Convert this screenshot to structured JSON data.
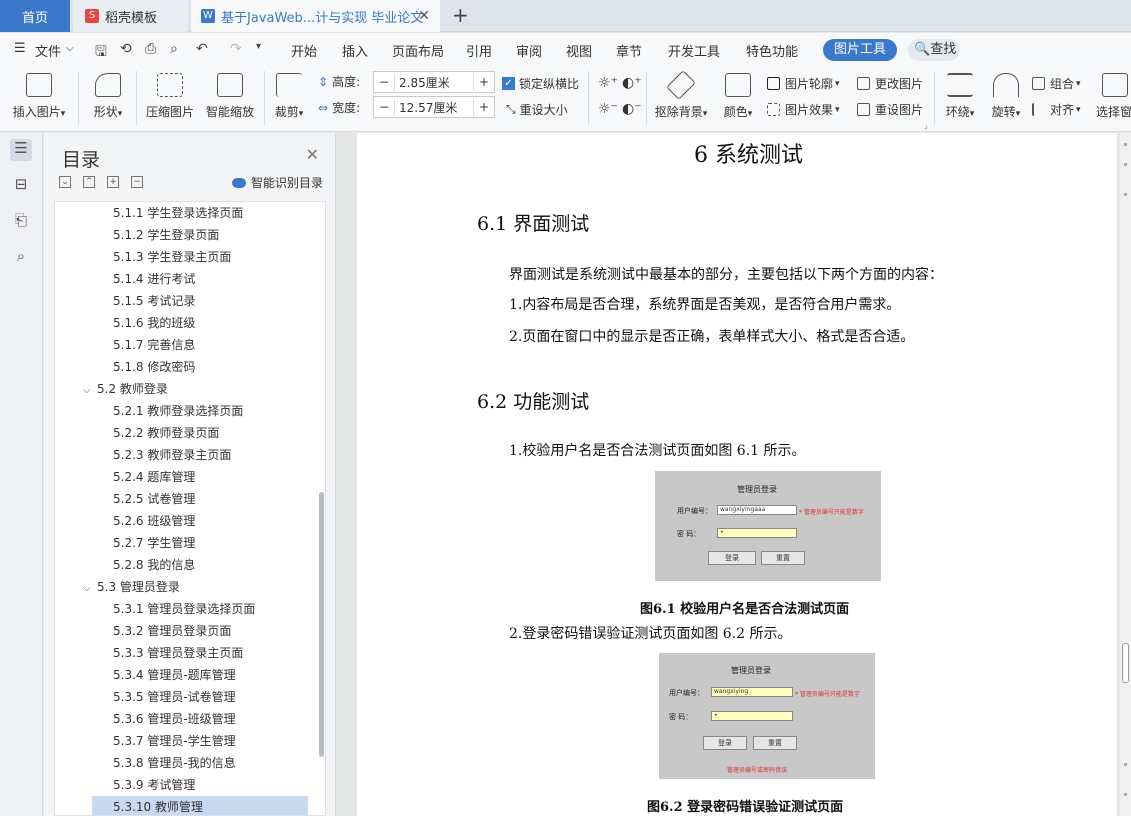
{
  "tabs": {
    "home": "首页",
    "template": "稻壳模板",
    "document": "基于JavaWeb...计与实现 毕业论文"
  },
  "ribbon_tabs": {
    "file": "文件",
    "start": "开始",
    "insert": "插入",
    "layout": "页面布局",
    "references": "引用",
    "review": "审阅",
    "view": "视图",
    "chapter": "章节",
    "dev": "开发工具",
    "special": "特色功能",
    "picture_tools": "图片工具",
    "search": "查找"
  },
  "toolbar": {
    "insert_picture": "插入图片",
    "shape": "形状",
    "compress": "压缩图片",
    "smart_zoom": "智能缩放",
    "crop": "裁剪",
    "height_label": "高度:",
    "height_value": "2.85厘米",
    "width_label": "宽度:",
    "width_value": "12.57厘米",
    "lock_ratio": "锁定纵横比",
    "reset_size": "重设大小",
    "remove_bg": "抠除背景",
    "color": "颜色",
    "pic_outline": "图片轮廓",
    "pic_effect": "图片效果",
    "change_pic": "更改图片",
    "reset_pic": "重设图片",
    "wrap": "环绕",
    "rotate": "旋转",
    "group": "组合",
    "align": "对齐",
    "select_pane": "选择窗"
  },
  "nav": {
    "title": "目录",
    "smart": "智能识别目录",
    "items": [
      {
        "label": "5.1.1  学生登录选择页面",
        "level": 3
      },
      {
        "label": "5.1.2  学生登录页面",
        "level": 3
      },
      {
        "label": "5.1.3  学生登录主页面",
        "level": 3
      },
      {
        "label": "5.1.4  进行考试",
        "level": 3
      },
      {
        "label": "5.1.5  考试记录",
        "level": 3
      },
      {
        "label": "5.1.6  我的班级",
        "level": 3
      },
      {
        "label": "5.1.7  完善信息",
        "level": 3
      },
      {
        "label": "5.1.8  修改密码",
        "level": 3
      },
      {
        "label": "5.2  教师登录",
        "level": 2
      },
      {
        "label": "5.2.1  教师登录选择页面",
        "level": 3
      },
      {
        "label": "5.2.2  教师登录页面",
        "level": 3
      },
      {
        "label": "5.2.3  教师登录主页面",
        "level": 3
      },
      {
        "label": "5.2.4  题库管理",
        "level": 3
      },
      {
        "label": "5.2.5  试卷管理",
        "level": 3
      },
      {
        "label": "5.2.6  班级管理",
        "level": 3
      },
      {
        "label": "5.2.7  学生管理",
        "level": 3
      },
      {
        "label": "5.2.8  我的信息",
        "level": 3
      },
      {
        "label": "5.3  管理员登录",
        "level": 2
      },
      {
        "label": "5.3.1  管理员登录选择页面",
        "level": 3
      },
      {
        "label": "5.3.2  管理员登录页面",
        "level": 3
      },
      {
        "label": "5.3.3  管理员登录主页面",
        "level": 3
      },
      {
        "label": "5.3.4  管理员-题库管理",
        "level": 3
      },
      {
        "label": "5.3.5  管理员-试卷管理",
        "level": 3
      },
      {
        "label": "5.3.6  管理员-班级管理",
        "level": 3
      },
      {
        "label": "5.3.7  管理员-学生管理",
        "level": 3
      },
      {
        "label": "5.3.8  管理员-我的信息",
        "level": 3
      },
      {
        "label": "5.3.9  考试管理",
        "level": 3
      },
      {
        "label": "5.3.10  教师管理",
        "level": 3,
        "active": true
      }
    ]
  },
  "doc": {
    "chapter": "6  系统测试",
    "s1_title": "6.1  界面测试",
    "s1_p1": "界面测试是系统测试中最基本的部分，主要包括以下两个方面的内容：",
    "s1_p2": "1.内容布局是否合理，系统界面是否美观，是否符合用户需求。",
    "s1_p3": "2.页面在窗口中的显示是否正确，表单样式大小、格式是否合适。",
    "s2_title": "6.2  功能测试",
    "s2_p1": "1.校验用户名是否合法测试页面如图 6.1 所示。",
    "fig1": {
      "title": "管理员登录",
      "user_label": "用户编号：",
      "user_value": "wangxiyingaaa",
      "user_error": "* 管理员编号只能是数字",
      "pwd_label": "密    码：",
      "pwd_value": "•",
      "login": "登录",
      "reset": "重置"
    },
    "fig1_caption": "图6.1 校验用户名是否合法测试页面",
    "s2_p2": "2.登录密码错误验证测试页面如图 6.2 所示。",
    "fig2": {
      "title": "管理员登录",
      "user_label": "用户编号：",
      "user_value": "wangxiying",
      "user_error": "* 管理员编号只能是数字",
      "pwd_label": "密    码：",
      "pwd_value": "•",
      "login": "登录",
      "reset": "重置",
      "msg": "管理员编号或密码错误"
    },
    "fig2_caption": "图6.2 登录密码错误验证测试页面"
  },
  "colors": {
    "accent": "#3a78c9",
    "nav_active": "#c9d9f2"
  }
}
